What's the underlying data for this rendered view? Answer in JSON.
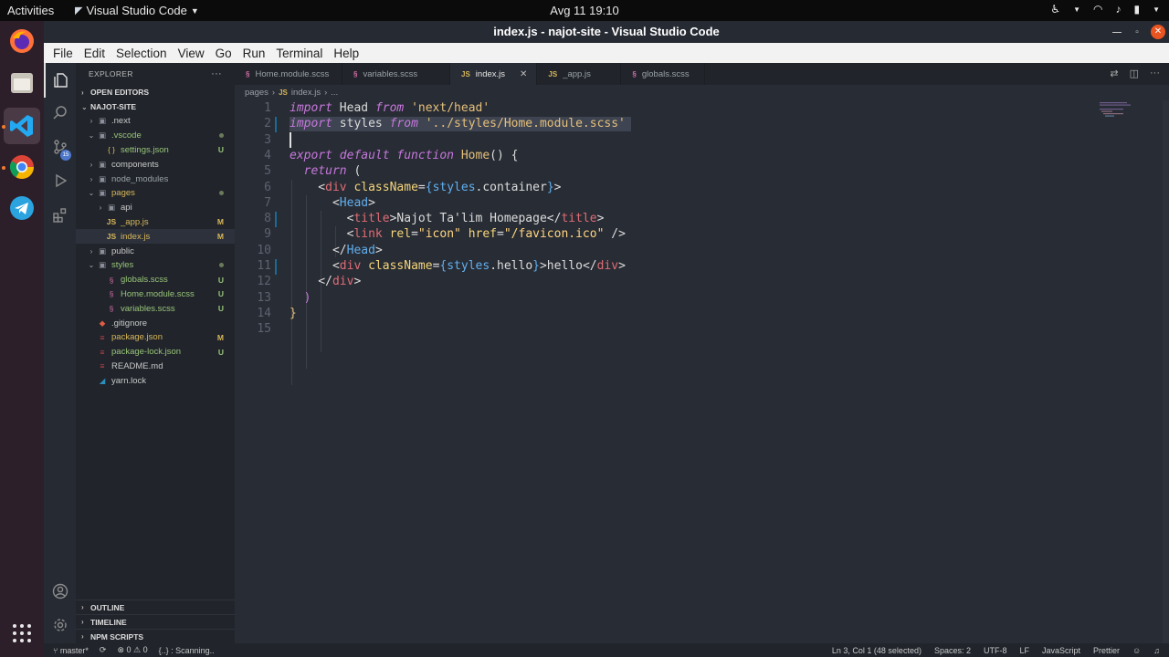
{
  "topbar": {
    "activities": "Activities",
    "app": "Visual Studio Code",
    "clock": "Avg 11  19:10"
  },
  "window": {
    "title": "index.js - najot-site - Visual Studio Code"
  },
  "menu": [
    "File",
    "Edit",
    "Selection",
    "View",
    "Go",
    "Run",
    "Terminal",
    "Help"
  ],
  "explorer": {
    "title": "EXPLORER",
    "more": "···",
    "open_editors": "OPEN EDITORS",
    "project": "NAJOT-SITE",
    "tree": [
      {
        "name": ".next",
        "icon": "▣",
        "level": 1,
        "chev": "›",
        "color": "#c8c8c8",
        "badge": "",
        "dot": false
      },
      {
        "name": ".vscode",
        "icon": "▣",
        "level": 1,
        "chev": "⌄",
        "color": "#98c379",
        "badge": "",
        "dot": true
      },
      {
        "name": "settings.json",
        "icon": "{ }",
        "level": 2,
        "chev": "",
        "color": "#98c379",
        "badge": "U",
        "dot": false
      },
      {
        "name": "components",
        "icon": "▣",
        "level": 1,
        "chev": "›",
        "color": "#c8c8c8",
        "badge": "",
        "dot": false
      },
      {
        "name": "node_modules",
        "icon": "▣",
        "level": 1,
        "chev": "›",
        "color": "#9aa0a8",
        "badge": "",
        "dot": false
      },
      {
        "name": "pages",
        "icon": "▣",
        "level": 1,
        "chev": "⌄",
        "color": "#d7b65a",
        "badge": "",
        "dot": true
      },
      {
        "name": "api",
        "icon": "▣",
        "level": 2,
        "chev": "›",
        "color": "#c8c8c8",
        "badge": "",
        "dot": false
      },
      {
        "name": "_app.js",
        "icon": "JS",
        "level": 2,
        "chev": "",
        "color": "#d7b65a",
        "badge": "M",
        "dot": false
      },
      {
        "name": "index.js",
        "icon": "JS",
        "level": 2,
        "chev": "",
        "color": "#d7b65a",
        "badge": "M",
        "dot": false,
        "selected": true
      },
      {
        "name": "public",
        "icon": "▣",
        "level": 1,
        "chev": "›",
        "color": "#c8c8c8",
        "badge": "",
        "dot": false
      },
      {
        "name": "styles",
        "icon": "▣",
        "level": 1,
        "chev": "⌄",
        "color": "#98c379",
        "badge": "",
        "dot": true
      },
      {
        "name": "globals.scss",
        "icon": "§",
        "level": 2,
        "chev": "",
        "color": "#98c379",
        "badge": "U",
        "dot": false
      },
      {
        "name": "Home.module.scss",
        "icon": "§",
        "level": 2,
        "chev": "",
        "color": "#98c379",
        "badge": "U",
        "dot": false
      },
      {
        "name": "variables.scss",
        "icon": "§",
        "level": 2,
        "chev": "",
        "color": "#98c379",
        "badge": "U",
        "dot": false
      },
      {
        "name": ".gitignore",
        "icon": "◆",
        "level": 1,
        "chev": "",
        "color": "#c8c8c8",
        "badge": "",
        "dot": false
      },
      {
        "name": "package.json",
        "icon": "≡",
        "level": 1,
        "chev": "",
        "color": "#d7b65a",
        "badge": "M",
        "dot": false
      },
      {
        "name": "package-lock.json",
        "icon": "≡",
        "level": 1,
        "chev": "",
        "color": "#98c379",
        "badge": "U",
        "dot": false
      },
      {
        "name": "README.md",
        "icon": "≡",
        "level": 1,
        "chev": "",
        "color": "#c8c8c8",
        "badge": "",
        "dot": false
      },
      {
        "name": "yarn.lock",
        "icon": "◢",
        "level": 1,
        "chev": "",
        "color": "#c8c8c8",
        "badge": "",
        "dot": false
      }
    ],
    "bottom": [
      "OUTLINE",
      "TIMELINE",
      "NPM SCRIPTS"
    ]
  },
  "tabs": [
    {
      "label": "Home.module.scss",
      "icon": "§",
      "active": false
    },
    {
      "label": "variables.scss",
      "icon": "§",
      "active": false
    },
    {
      "label": "index.js",
      "icon": "JS",
      "active": true
    },
    {
      "label": "_app.js",
      "icon": "JS",
      "active": false
    },
    {
      "label": "globals.scss",
      "icon": "§",
      "active": false
    }
  ],
  "breadcrumb": {
    "folder": "pages",
    "file": "index.js",
    "more": "..."
  },
  "code": {
    "line_numbers": [
      "1",
      "2",
      "3",
      "4",
      "5",
      "6",
      "7",
      "8",
      "9",
      "10",
      "11",
      "12",
      "13",
      "14",
      "15"
    ],
    "lines": [
      [
        {
          "t": "import",
          "c": "kw"
        },
        {
          "t": " Head ",
          "c": ""
        },
        {
          "t": "from",
          "c": "kw"
        },
        {
          "t": " 'next/head'",
          "c": "str"
        }
      ],
      [
        {
          "t": "import",
          "c": "kw"
        },
        {
          "t": " styles ",
          "c": ""
        },
        {
          "t": "from",
          "c": "kw"
        },
        {
          "t": " '../styles/Home.module.scss'",
          "c": "str"
        }
      ],
      [],
      [
        {
          "t": "export default function",
          "c": "kw"
        },
        {
          "t": " Home",
          "c": "fn2"
        },
        {
          "t": "() {",
          "c": "br"
        }
      ],
      [
        {
          "t": "  ",
          "c": ""
        },
        {
          "t": "return",
          "c": "kw"
        },
        {
          "t": " (",
          "c": "br"
        }
      ],
      [
        {
          "t": "    <",
          "c": "br"
        },
        {
          "t": "div",
          "c": "tag"
        },
        {
          "t": " className",
          "c": "attr"
        },
        {
          "t": "=",
          "c": "br"
        },
        {
          "t": "{",
          "c": "fn"
        },
        {
          "t": "styles",
          "c": "fn"
        },
        {
          "t": ".container",
          "c": ""
        },
        {
          "t": "}",
          "c": "fn"
        },
        {
          "t": ">",
          "c": "br"
        }
      ],
      [
        {
          "t": "      <",
          "c": "br"
        },
        {
          "t": "Head",
          "c": "fn"
        },
        {
          "t": ">",
          "c": "br"
        }
      ],
      [
        {
          "t": "        <",
          "c": "br"
        },
        {
          "t": "title",
          "c": "tag"
        },
        {
          "t": ">Najot Ta'lim Homepage</",
          "c": ""
        },
        {
          "t": "title",
          "c": "tag"
        },
        {
          "t": ">",
          "c": "br"
        }
      ],
      [
        {
          "t": "        <",
          "c": "br"
        },
        {
          "t": "link",
          "c": "tag"
        },
        {
          "t": " rel",
          "c": "attr"
        },
        {
          "t": "=",
          "c": "br"
        },
        {
          "t": "\"icon\"",
          "c": "str2"
        },
        {
          "t": " href",
          "c": "attr"
        },
        {
          "t": "=",
          "c": "br"
        },
        {
          "t": "\"/favicon.ico\"",
          "c": "str2"
        },
        {
          "t": " />",
          "c": "br"
        }
      ],
      [
        {
          "t": "      </",
          "c": "br"
        },
        {
          "t": "Head",
          "c": "fn"
        },
        {
          "t": ">",
          "c": "br"
        }
      ],
      [
        {
          "t": "      <",
          "c": "br"
        },
        {
          "t": "div",
          "c": "tag"
        },
        {
          "t": " className",
          "c": "attr"
        },
        {
          "t": "=",
          "c": "br"
        },
        {
          "t": "{",
          "c": "fn"
        },
        {
          "t": "styles",
          "c": "fn"
        },
        {
          "t": ".hello",
          "c": ""
        },
        {
          "t": "}",
          "c": "fn"
        },
        {
          "t": ">hello</",
          "c": ""
        },
        {
          "t": "div",
          "c": "tag"
        },
        {
          "t": ">",
          "c": "br"
        }
      ],
      [
        {
          "t": "    </",
          "c": "br"
        },
        {
          "t": "div",
          "c": "tag"
        },
        {
          "t": ">",
          "c": "br"
        }
      ],
      [
        {
          "t": "  )",
          "c": "kw-plain"
        }
      ],
      [
        {
          "t": "}",
          "c": "fn2"
        }
      ],
      []
    ]
  },
  "status": {
    "branch": "master*",
    "errors": "⊗ 0  ⚠ 0",
    "scanning": "{..} : Scanning..",
    "position": "Ln 3, Col 1 (48 selected)",
    "spaces": "Spaces: 2",
    "encoding": "UTF-8",
    "eol": "LF",
    "language": "JavaScript",
    "formatter": "Prettier"
  },
  "colors": {
    "accent": "#e95420",
    "dock": "#2d1f2a",
    "editor_bg": "#282c34"
  }
}
